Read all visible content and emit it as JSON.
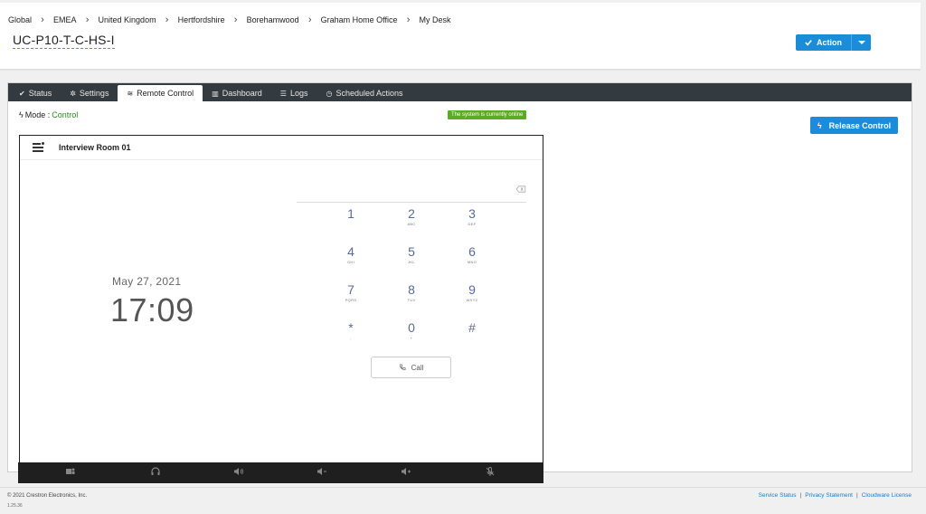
{
  "breadcrumb": [
    "Global",
    "EMEA",
    "United Kingdom",
    "Hertfordshire",
    "Borehamwood",
    "Graham Home Office",
    "My Desk"
  ],
  "device": {
    "name": "UC-P10-T-C-HS-I"
  },
  "header": {
    "action_label": "Action"
  },
  "tabs": [
    {
      "label": "Status",
      "icon": "check-icon"
    },
    {
      "label": "Settings",
      "icon": "gear-icon"
    },
    {
      "label": "Remote Control",
      "icon": "signal-icon",
      "active": true
    },
    {
      "label": "Dashboard",
      "icon": "bar-chart-icon"
    },
    {
      "label": "Logs",
      "icon": "list-icon"
    },
    {
      "label": "Scheduled Actions",
      "icon": "clock-icon"
    }
  ],
  "remote": {
    "mode_label": "Mode :",
    "mode_value": "Control",
    "status_badge": "The system is currently online",
    "release_label": "Release Control"
  },
  "panel": {
    "room_name": "Interview Room 01",
    "date": "May 27, 2021",
    "time": "17:09",
    "keypad": [
      {
        "digit": "1",
        "letters": ""
      },
      {
        "digit": "2",
        "letters": "ABC"
      },
      {
        "digit": "3",
        "letters": "DEF"
      },
      {
        "digit": "4",
        "letters": "GHI"
      },
      {
        "digit": "5",
        "letters": "JKL"
      },
      {
        "digit": "6",
        "letters": "MNO"
      },
      {
        "digit": "7",
        "letters": "PQRS"
      },
      {
        "digit": "8",
        "letters": "TUV"
      },
      {
        "digit": "9",
        "letters": "WXYZ"
      },
      {
        "digit": "*",
        "letters": ","
      },
      {
        "digit": "0",
        "letters": "+"
      },
      {
        "digit": "#",
        "letters": "."
      }
    ],
    "call_label": "Call",
    "bottom_bar_icons": [
      "teams-icon",
      "headset-icon",
      "volume-up-icon",
      "volume-down-icon",
      "volume-icon",
      "mic-mute-icon"
    ]
  },
  "footer": {
    "copyright": "© 2021 Crestron Electronics, Inc.",
    "version": "1.25.36",
    "links": [
      "Service Status",
      "Privacy Statement",
      "Cloudware License"
    ]
  },
  "colors": {
    "accent": "#1a8cd8",
    "online": "#5cab25",
    "mode": "#2b8a1f",
    "tabbar": "#333a40",
    "keypad": "#5a6a96"
  }
}
